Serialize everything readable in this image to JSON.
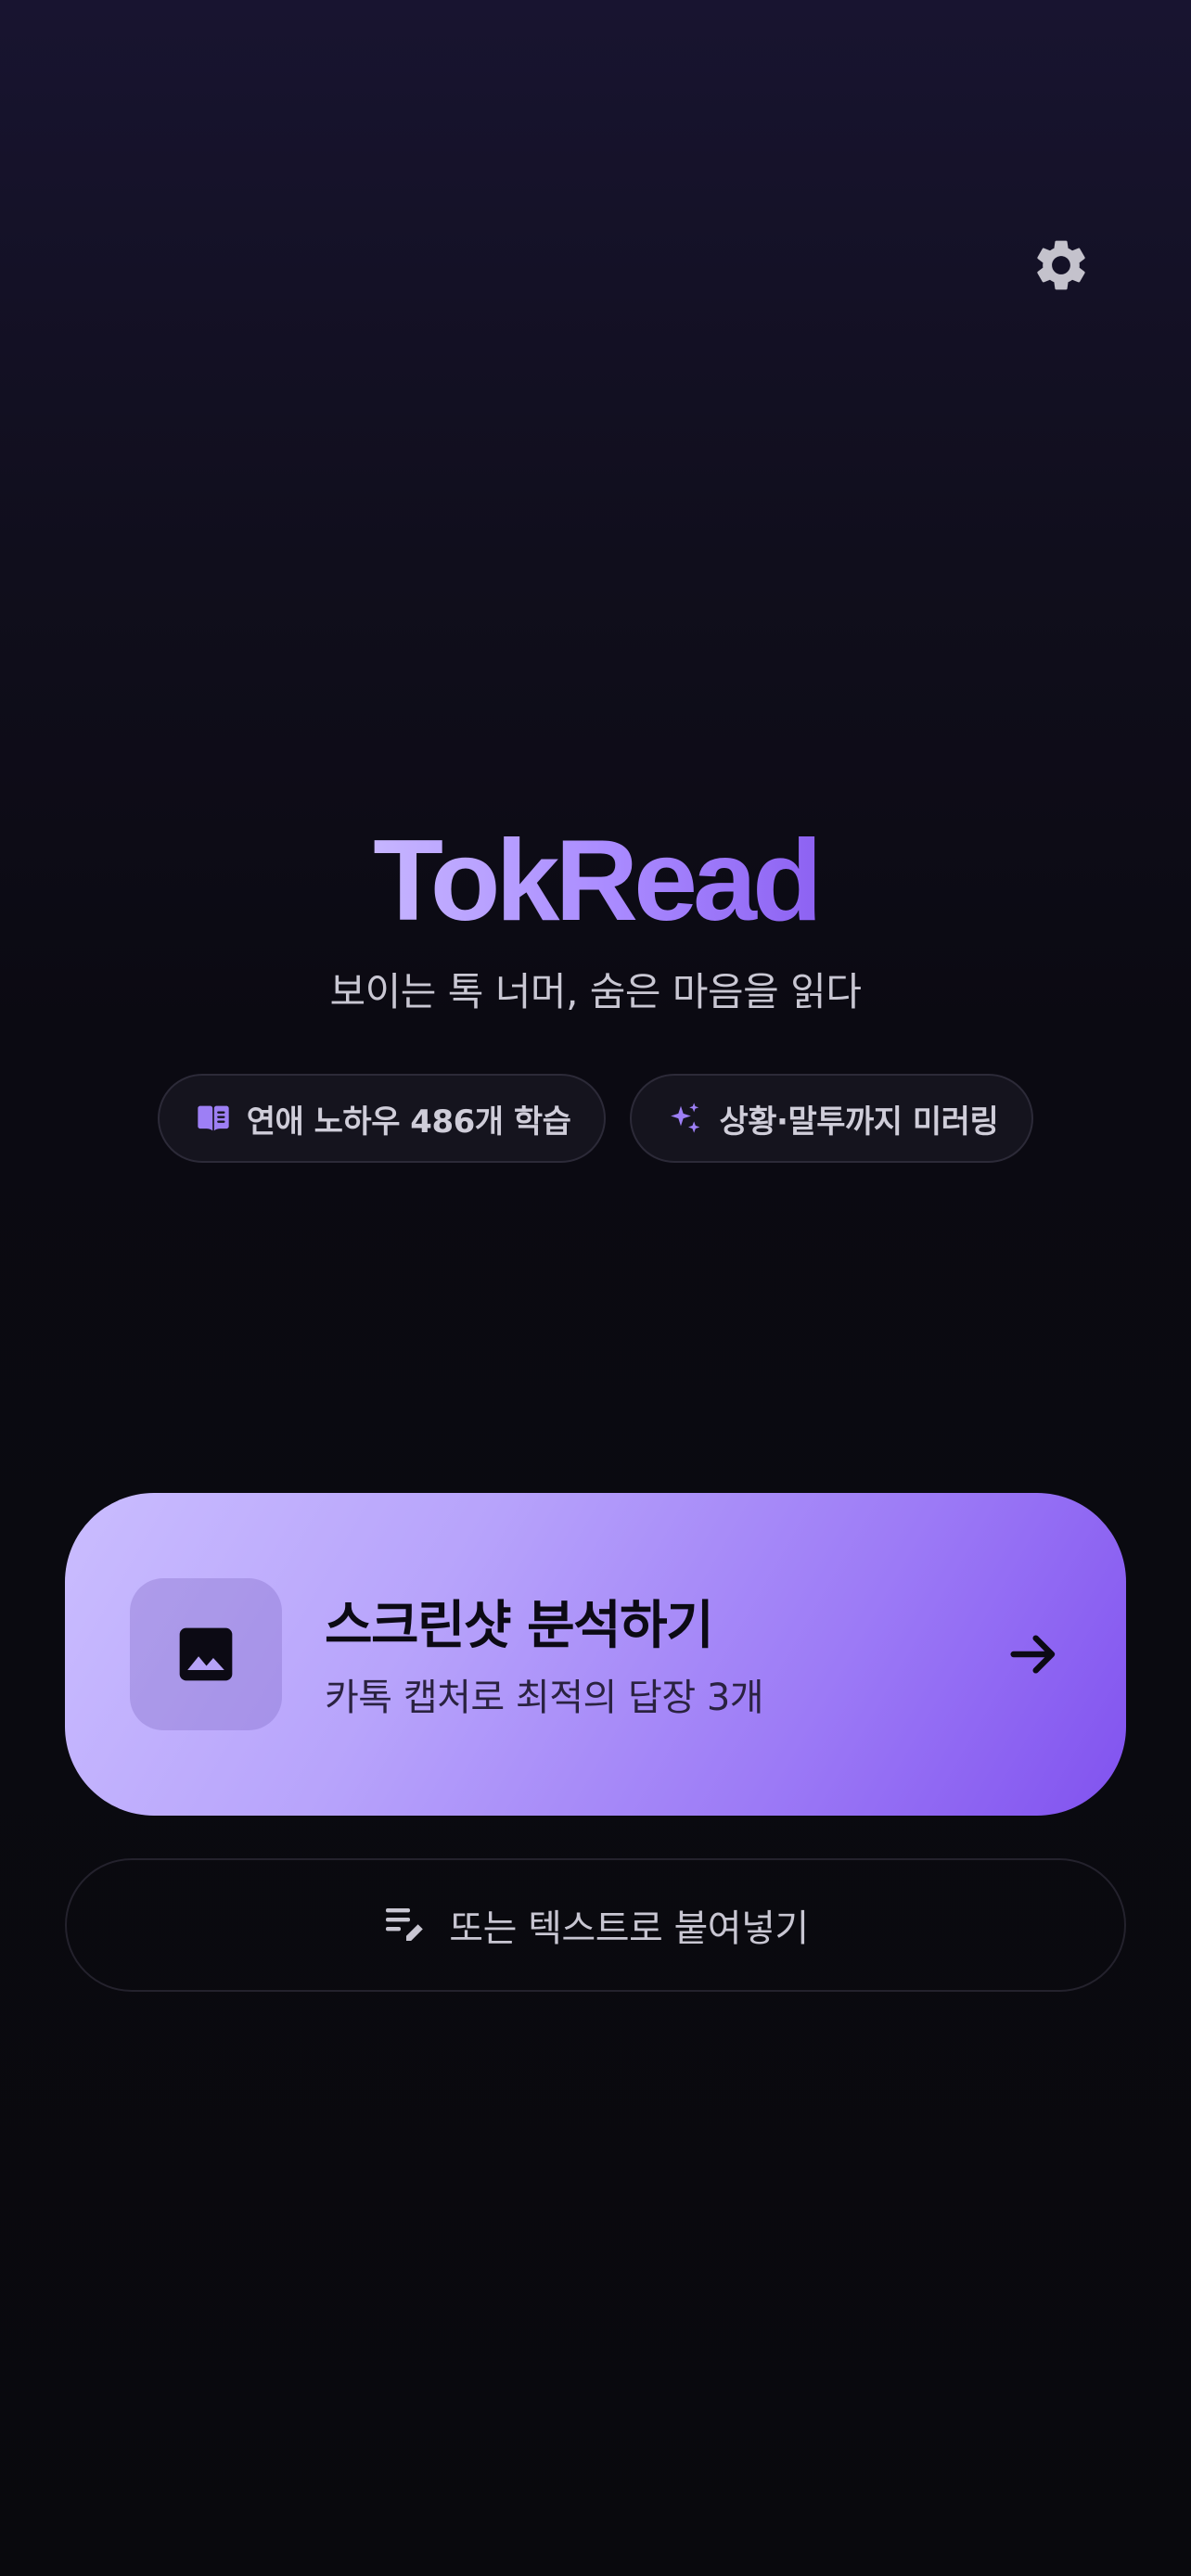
{
  "header": {
    "settings_icon": "gear-icon"
  },
  "hero": {
    "title": "TokRead",
    "tagline": "보이는 톡 너머, 숨은 마음을 읽다"
  },
  "chips": [
    {
      "icon": "book-icon",
      "label": "연애 노하우 486개 학습"
    },
    {
      "icon": "sparkle-icon",
      "label": "상황·말투까지 미러링"
    }
  ],
  "primary_action": {
    "icon": "image-icon",
    "title": "스크린샷 분석하기",
    "subtitle": "카톡 캡처로 최적의 답장 3개",
    "arrow_icon": "arrow-right-icon"
  },
  "secondary_action": {
    "icon": "edit-text-icon",
    "label": "또는 텍스트로 붙여넣기"
  },
  "colors": {
    "accent": "#a98aff",
    "card_start": "#cabdff",
    "card_end": "#8152ef",
    "background": "#09090d"
  }
}
